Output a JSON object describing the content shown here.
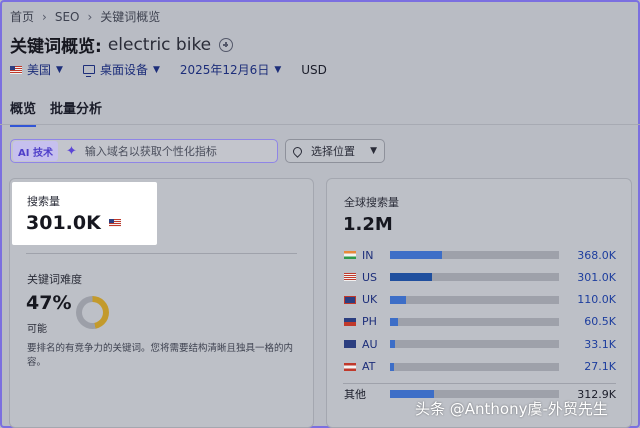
{
  "breadcrumb": {
    "items": [
      "首页",
      "SEO",
      "关键词概览"
    ]
  },
  "title": {
    "prefix": "关键词概览:",
    "keyword": "electric bike"
  },
  "filters": {
    "country": "美国",
    "device": "桌面设备",
    "date": "2025年12月6日",
    "currency": "USD"
  },
  "tabs": [
    "概览",
    "批量分析"
  ],
  "ai_bar": {
    "badge": "AI 技术",
    "placeholder": "输入域名以获取个性化指标"
  },
  "location_select": {
    "label": "选择位置"
  },
  "search_volume": {
    "label": "搜索量",
    "value": "301.0K"
  },
  "keyword_difficulty": {
    "label": "关键词难度",
    "value": "47%",
    "percent": 47,
    "level": "可能",
    "description": "要排名的有竞争力的关键词。您将需要结构清晰且独具一格的内容。"
  },
  "global_volume": {
    "label": "全球搜索量",
    "value": "1.2M",
    "countries": [
      {
        "code": "IN",
        "value": "368.0K",
        "share": 0.306
      },
      {
        "code": "US",
        "value": "301.0K",
        "share": 0.25
      },
      {
        "code": "UK",
        "value": "110.0K",
        "share": 0.092
      },
      {
        "code": "PH",
        "value": "60.5K",
        "share": 0.05
      },
      {
        "code": "AU",
        "value": "33.1K",
        "share": 0.028
      },
      {
        "code": "AT",
        "value": "27.1K",
        "share": 0.023
      }
    ],
    "other": {
      "label": "其他",
      "value": "312.9K",
      "share": 0.26
    }
  },
  "watermark": "头条 @Anthony虞-外贸先生",
  "colors": {
    "accent": "#3256d6",
    "bar": "#3d6ec7",
    "ai_border": "#8f85e6",
    "difficulty": "#c39a2c"
  }
}
